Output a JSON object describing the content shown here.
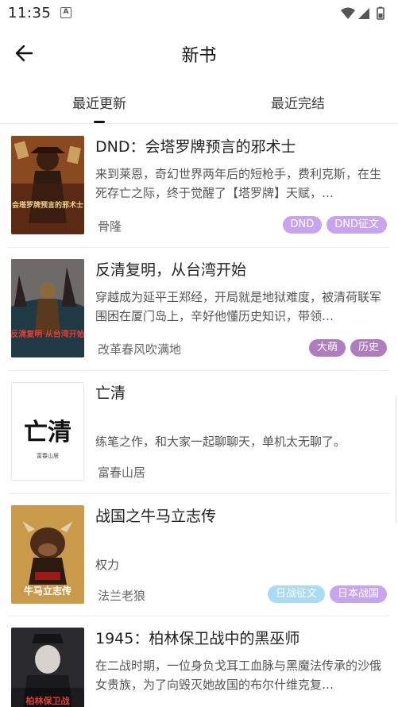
{
  "status_bar": {
    "time": "11:35",
    "notification_badge": "A"
  },
  "header": {
    "title": "新书"
  },
  "tabs": [
    {
      "label": "最近更新",
      "active": true
    },
    {
      "label": "最近完结",
      "active": false
    }
  ],
  "books": [
    {
      "title": "DND：会塔罗牌预言的邪术士",
      "description": "来到莱恩，奇幻世界两年后的短枪手，费利克斯，在生死存亡之际，终于觉醒了【塔罗牌】天赋，…",
      "author": "骨隆",
      "tags": [
        {
          "label": "DND",
          "color": "#c9a4ee"
        },
        {
          "label": "DND征文",
          "color": "#c9a4ee"
        }
      ],
      "cover_text": "会塔罗牌预言的邪术士"
    },
    {
      "title": "反清复明，从台湾开始",
      "description": "穿越成为延平王郑经，开局就是地狱难度，被清荷联军围困在厦门岛上，辛好他懂历史知识，带领…",
      "author": "改革春风吹满地",
      "tags": [
        {
          "label": "大萌",
          "color": "#b07cc0"
        },
        {
          "label": "历史",
          "color": "#b07cc0"
        }
      ],
      "cover_text": "反清复明 从台湾开始"
    },
    {
      "title": "亡清",
      "description": "练笔之作，和大家一起聊聊天，单机太无聊了。",
      "author": "富春山居",
      "tags": [],
      "cover_text": "亡清"
    },
    {
      "title": "战国之牛马立志传",
      "description": "权力",
      "author": "法兰老狼",
      "tags": [
        {
          "label": "日战征文",
          "color": "#a9dcf2"
        },
        {
          "label": "日本战国",
          "color": "#c9a4ee"
        }
      ],
      "cover_text": "牛马立志传"
    },
    {
      "title": "1945：柏林保卫战中的黑巫师",
      "description": "在二战时期，一位身负戈耳工血脉与黑魔法传承的沙俄女贵族，为了向毁灭她故国的布尔什维克复…",
      "author": "",
      "tags": [],
      "cover_text": "柏林保卫战"
    }
  ]
}
